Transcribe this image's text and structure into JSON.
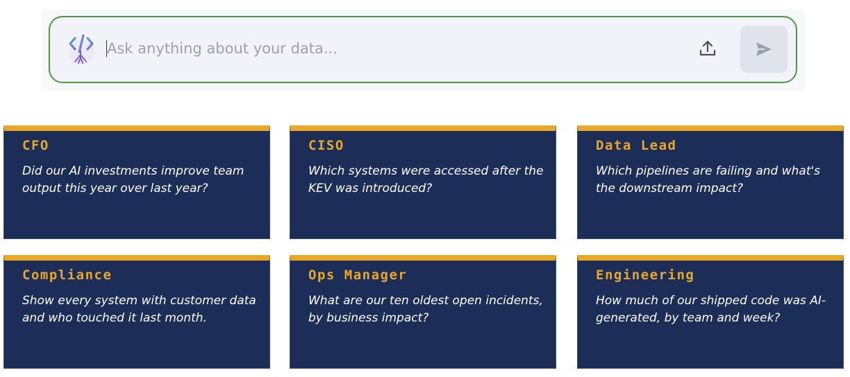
{
  "search": {
    "placeholder": "Ask anything about your data...",
    "value": "",
    "logo_icon": "code-tree-logo-icon",
    "upload_icon": "upload-icon",
    "send_icon": "send-icon",
    "border_color": "#4a9a3e"
  },
  "theme": {
    "card_bg": "#1c2d57",
    "accent": "#e9a825"
  },
  "cards": [
    {
      "title": "CFO",
      "question": "Did our AI investments improve team output this year over last year?"
    },
    {
      "title": "CISO",
      "question": "Which systems were accessed after the KEV was introduced?"
    },
    {
      "title": "Data Lead",
      "question": "Which pipelines are failing and what's the downstream impact?"
    },
    {
      "title": "Compliance",
      "question": "Show every system with customer data and who touched it last month."
    },
    {
      "title": "Ops Manager",
      "question": "What are our ten oldest open incidents, by business impact?"
    },
    {
      "title": "Engineering",
      "question": "How much of our shipped code was AI-generated, by team and week?"
    }
  ]
}
